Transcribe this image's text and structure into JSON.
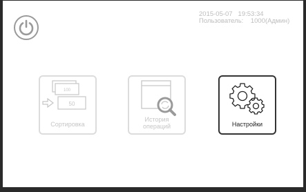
{
  "header": {
    "date": "2015-05-07",
    "time": "19:53:34",
    "user_label": "Пользователь:",
    "user_value": "1000(Админ)"
  },
  "power_button": {
    "icon": "power-icon"
  },
  "tiles": [
    {
      "id": "sort",
      "label": "Сортировка",
      "icon": "banknote-sorting-icon",
      "note_top": "100",
      "note_front": "50",
      "enabled": false
    },
    {
      "id": "history",
      "label_line1": "История",
      "label_line2": "операций",
      "icon": "history-search-icon",
      "enabled": false
    },
    {
      "id": "settings",
      "label": "Настройки",
      "icon": "gears-icon",
      "enabled": true
    }
  ],
  "colors": {
    "frame": "#2a2a2a",
    "disabled": "#c6c6c6",
    "active": "#333333",
    "status_text": "#bdbdbd"
  }
}
